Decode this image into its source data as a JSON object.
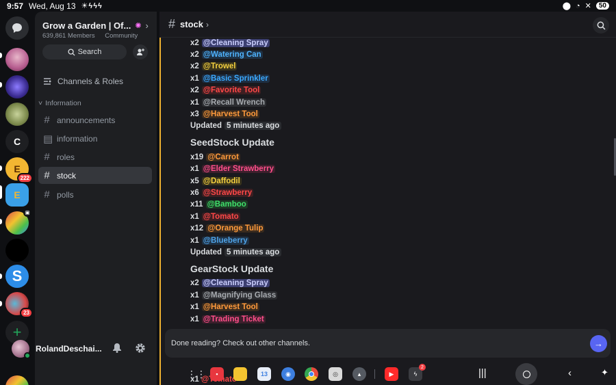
{
  "statusbar": {
    "time": "9:57",
    "date": "Wed, Aug 13",
    "notifications": "☀ϟϟϟ",
    "battery": "50"
  },
  "rail": {
    "dm_icon": "chat-bubble-icon",
    "servers": [
      {
        "name": "server-1",
        "color": "#b65d8f"
      },
      {
        "name": "server-2",
        "color": "#4a3aa0"
      },
      {
        "name": "server-3",
        "color": "#7c8a4c"
      },
      {
        "name": "server-c",
        "letter": "C",
        "color": "#1e1f22"
      },
      {
        "name": "server-e1",
        "letter": "E",
        "badge": "222",
        "color": "#f2b632"
      },
      {
        "name": "server-e2",
        "letter": "E",
        "color": "#3aa0e8"
      },
      {
        "name": "server-garden",
        "color": "#4bbf4b"
      },
      {
        "name": "server-black",
        "color": "#000000"
      },
      {
        "name": "server-s",
        "letter": "S",
        "color": "#2d8de8"
      },
      {
        "name": "server-game",
        "badge": "23",
        "color": "#d84848"
      }
    ],
    "add_icon": "+"
  },
  "guild": {
    "name": "Grow a Garden | Of...",
    "members": "639,861 Members",
    "type": "Community",
    "search_label": "Search",
    "channels_roles": "Channels & Roles",
    "category": "Information",
    "channels": [
      "announcements",
      "information",
      "roles",
      "stock",
      "polls"
    ]
  },
  "user": {
    "name": "RolandDeschai..."
  },
  "channel": {
    "title": "stock"
  },
  "messages": {
    "block1": [
      {
        "qty": "x2",
        "item": "@Cleaning Spray",
        "color": "#c9cdfb",
        "bg": "#3c3f70"
      },
      {
        "qty": "x2",
        "item": "@Watering Can",
        "color": "#4fb3ff",
        "bg": "#1f3144"
      },
      {
        "qty": "x2",
        "item": "@Trowel",
        "color": "#f4d03f",
        "bg": "#3a341c"
      },
      {
        "qty": "x1",
        "item": "@Basic Sprinkler",
        "color": "#3ba9ff",
        "bg": "#1e2f43"
      },
      {
        "qty": "x2",
        "item": "@Favorite Tool",
        "color": "#ff4848",
        "bg": "#3d1f22"
      },
      {
        "qty": "x1",
        "item": "@Recall Wrench",
        "color": "#a7abb0",
        "bg": "#2c2d31"
      },
      {
        "qty": "x3",
        "item": "@Harvest Tool",
        "color": "#ff9a3c",
        "bg": "#3a2b1e"
      }
    ],
    "updated_label": "Updated",
    "updated_when": "5 minutes ago",
    "seed_heading": "SeedStock Update",
    "seed": [
      {
        "qty": "x19",
        "item": "@Carrot",
        "color": "#ff9a3c",
        "bg": "#3a2b1e"
      },
      {
        "qty": "x1",
        "item": "@Elder Strawberry",
        "color": "#ff4f8b",
        "bg": "#3d1f2c"
      },
      {
        "qty": "x5",
        "item": "@Daffodil",
        "color": "#f4d03f",
        "bg": "#3a341c"
      },
      {
        "qty": "x6",
        "item": "@Strawberry",
        "color": "#ff4848",
        "bg": "#3d1f22"
      },
      {
        "qty": "x11",
        "item": "@Bamboo",
        "color": "#3fe06a",
        "bg": "#1e3a25"
      },
      {
        "qty": "x1",
        "item": "@Tomato",
        "color": "#ff4848",
        "bg": "#3d1f22"
      },
      {
        "qty": "x12",
        "item": "@Orange Tulip",
        "color": "#ff9a3c",
        "bg": "#3a2b1e"
      },
      {
        "qty": "x1",
        "item": "@Blueberry",
        "color": "#4fa3e8",
        "bg": "#1f3144"
      }
    ],
    "gear_heading": "GearStock Update",
    "gear": [
      {
        "qty": "x2",
        "item": "@Cleaning Spray",
        "color": "#c9cdfb",
        "bg": "#3c3f70"
      },
      {
        "qty": "x1",
        "item": "@Magnifying Glass",
        "color": "#a7abb0",
        "bg": "#2c2d31"
      },
      {
        "qty": "x1",
        "item": "@Harvest Tool",
        "color": "#ff9a3c",
        "bg": "#3a2b1e"
      },
      {
        "qty": "x1",
        "item": "@Trading Ticket",
        "color": "#ff4f8b",
        "bg": "#3d1f2c"
      }
    ],
    "overflow_line": {
      "qty": "x1",
      "item": "@Tomato"
    }
  },
  "banner": {
    "text": "Done reading? Check out other channels."
  },
  "taskbar": {
    "apps": [
      {
        "name": "apps-grid-icon"
      },
      {
        "name": "app-red",
        "color": "#e8373f"
      },
      {
        "name": "app-notes",
        "color": "#f4c430"
      },
      {
        "name": "app-calendar",
        "color": "#3d7fe0",
        "label": "13"
      },
      {
        "name": "app-messages",
        "color": "#3d7fe0"
      },
      {
        "name": "app-chrome",
        "color": "#e8e8e8"
      },
      {
        "name": "app-camera",
        "color": "#d9d9d9"
      },
      {
        "name": "app-recent",
        "color": "#555a62"
      },
      {
        "name": "app-youtube",
        "color": "#ff2a2a"
      },
      {
        "name": "app-discord-alt",
        "color": "#3a3b40",
        "badge": "2"
      }
    ]
  }
}
